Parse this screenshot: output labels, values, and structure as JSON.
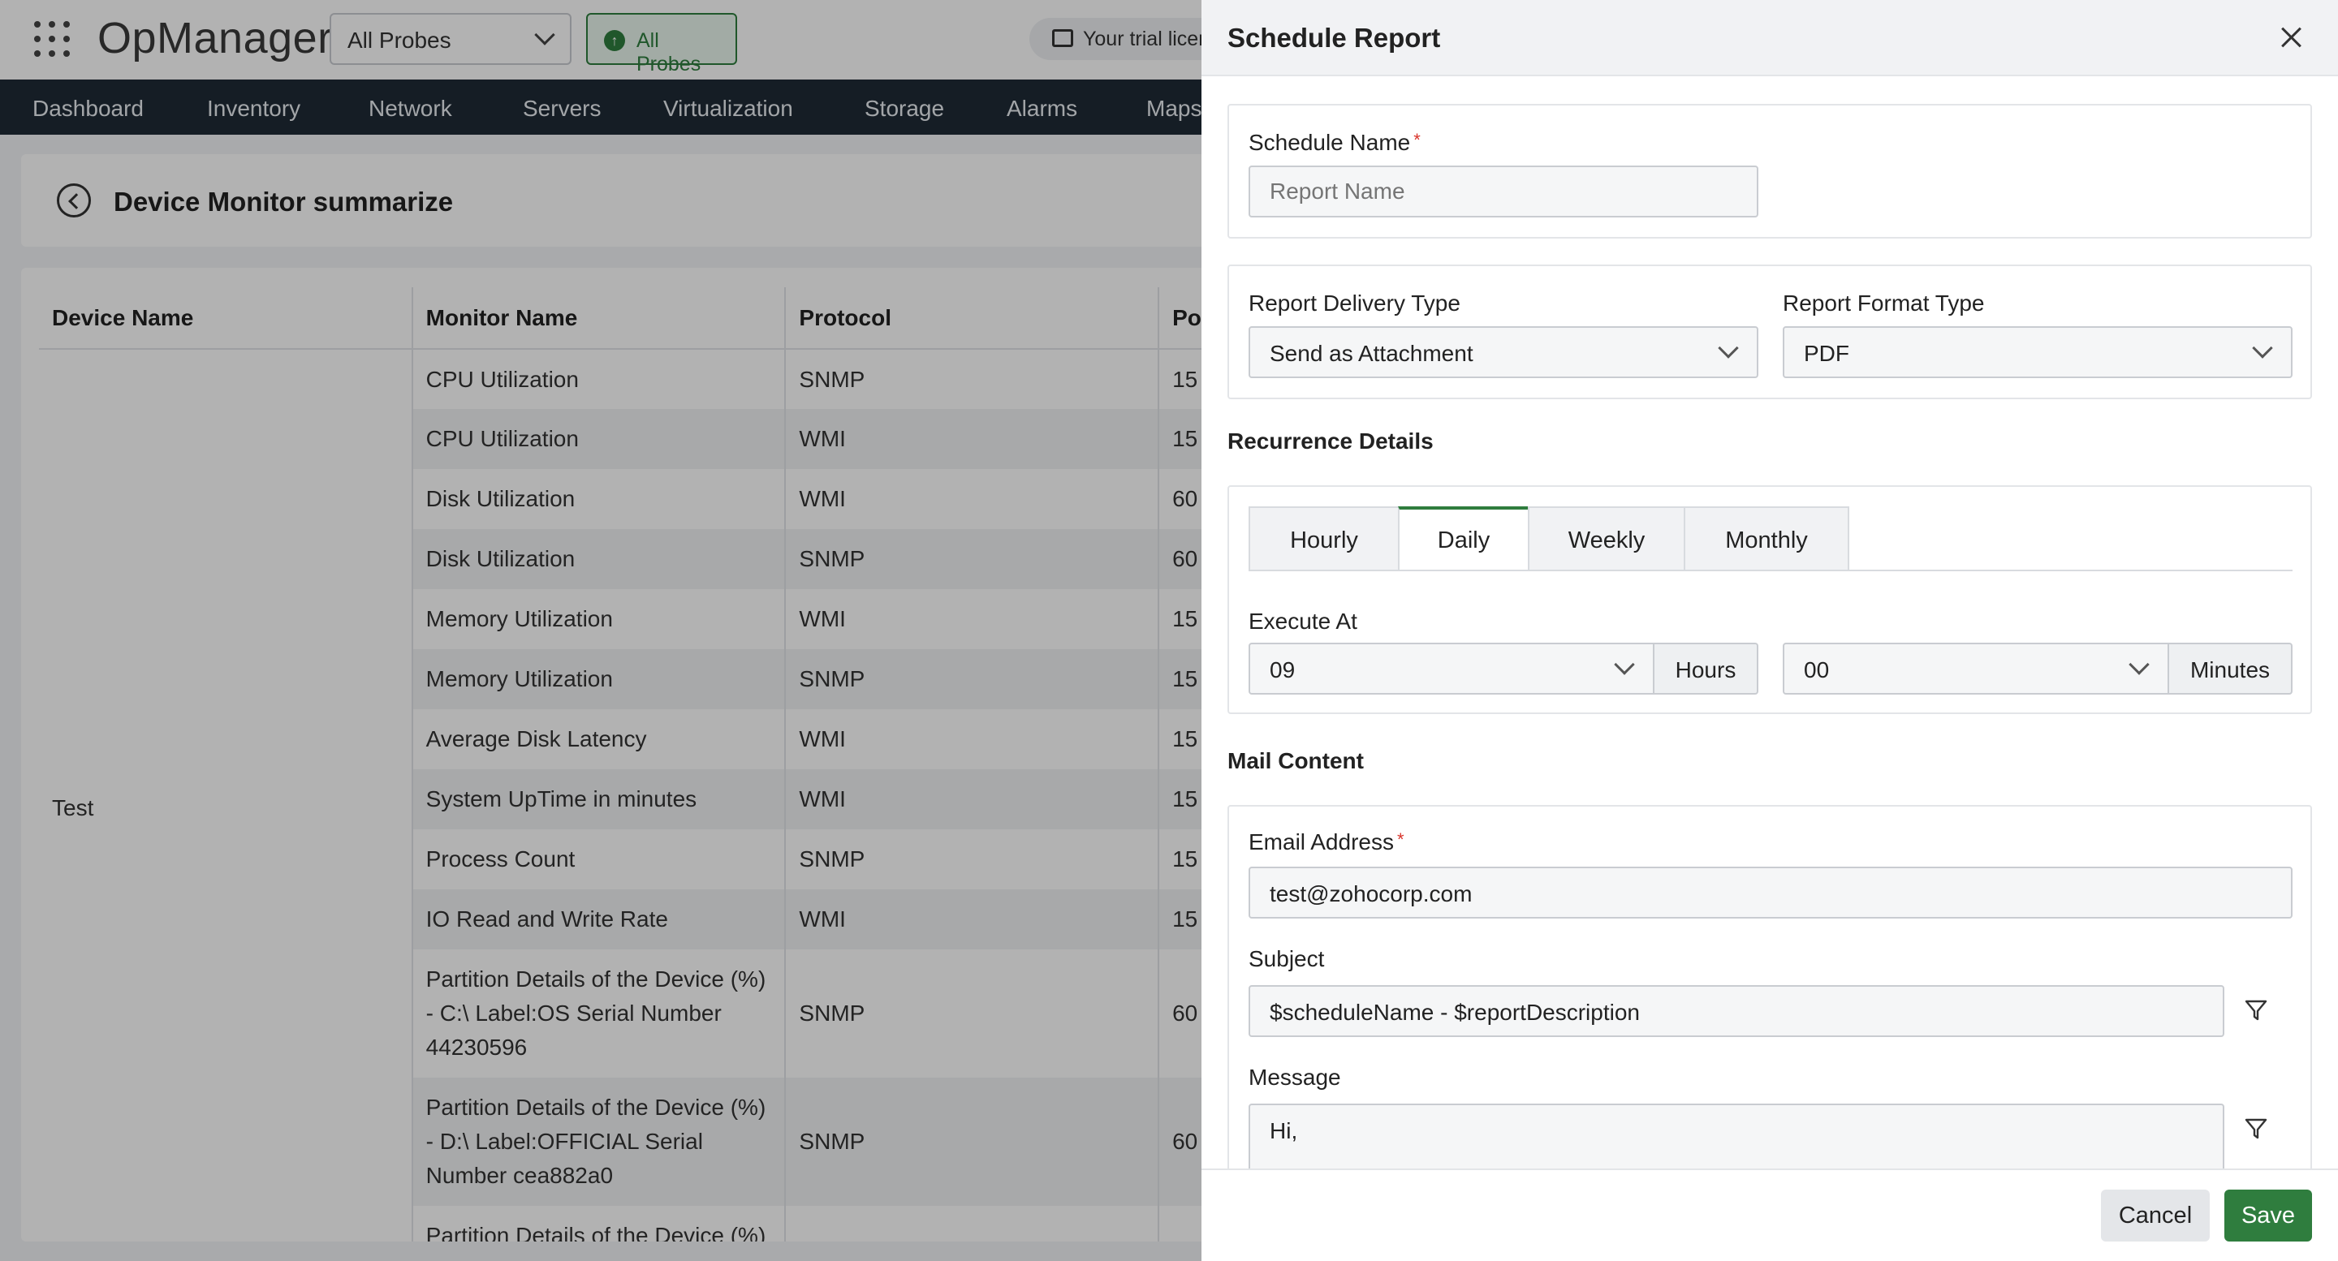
{
  "app": {
    "brand": "OpManager",
    "probe_select": "All Probes",
    "probe_badge": "All Probes",
    "trial_text": "Your trial licen"
  },
  "nav": {
    "items": [
      "Dashboard",
      "Inventory",
      "Network",
      "Servers",
      "Virtualization",
      "Storage",
      "Alarms",
      "Maps"
    ]
  },
  "page": {
    "title": "Device Monitor summarize"
  },
  "table": {
    "headers": [
      "Device Name",
      "Monitor Name",
      "Protocol",
      "Po"
    ],
    "device": "Test",
    "rows": [
      {
        "monitor": "CPU Utilization",
        "protocol": "SNMP",
        "poll": "15"
      },
      {
        "monitor": "CPU Utilization",
        "protocol": "WMI",
        "poll": "15"
      },
      {
        "monitor": "Disk Utilization",
        "protocol": "WMI",
        "poll": "60"
      },
      {
        "monitor": "Disk Utilization",
        "protocol": "SNMP",
        "poll": "60"
      },
      {
        "monitor": "Memory Utilization",
        "protocol": "WMI",
        "poll": "15"
      },
      {
        "monitor": "Memory Utilization",
        "protocol": "SNMP",
        "poll": "15"
      },
      {
        "monitor": "Average Disk Latency",
        "protocol": "WMI",
        "poll": "15"
      },
      {
        "monitor": "System UpTime in minutes",
        "protocol": "WMI",
        "poll": "15"
      },
      {
        "monitor": "Process Count",
        "protocol": "SNMP",
        "poll": "15"
      },
      {
        "monitor": "IO Read and Write Rate",
        "protocol": "WMI",
        "poll": "15"
      },
      {
        "monitor": "Partition Details of the Device (%) - C:\\ Label:OS Serial Number 44230596",
        "protocol": "SNMP",
        "poll": "60"
      },
      {
        "monitor": "Partition Details of the Device (%) - D:\\ Label:OFFICIAL Serial Number cea882a0",
        "protocol": "SNMP",
        "poll": "60"
      },
      {
        "monitor": "Partition Details of the Device (%)",
        "protocol": "",
        "poll": ""
      }
    ]
  },
  "drawer": {
    "title": "Schedule Report",
    "schedule_name_label": "Schedule Name",
    "schedule_name_placeholder": "Report Name",
    "required_mark": "*",
    "delivery_type_label": "Report Delivery Type",
    "delivery_type_value": "Send as Attachment",
    "format_type_label": "Report Format Type",
    "format_type_value": "PDF",
    "recurrence_title": "Recurrence Details",
    "tabs": [
      "Hourly",
      "Daily",
      "Weekly",
      "Monthly"
    ],
    "active_tab": "Daily",
    "execute_at_label": "Execute At",
    "hours_value": "09",
    "hours_unit": "Hours",
    "minutes_value": "00",
    "minutes_unit": "Minutes",
    "mail_title": "Mail Content",
    "email_label": "Email Address",
    "email_value": "test@zohocorp.com",
    "subject_label": "Subject",
    "subject_value": "$scheduleName - $reportDescription",
    "message_label": "Message",
    "message_value": "Hi,",
    "cancel_label": "Cancel",
    "save_label": "Save"
  },
  "colors": {
    "accent": "#2f7d3e",
    "nav_bg": "#1f2a36",
    "required": "#d9342b"
  }
}
